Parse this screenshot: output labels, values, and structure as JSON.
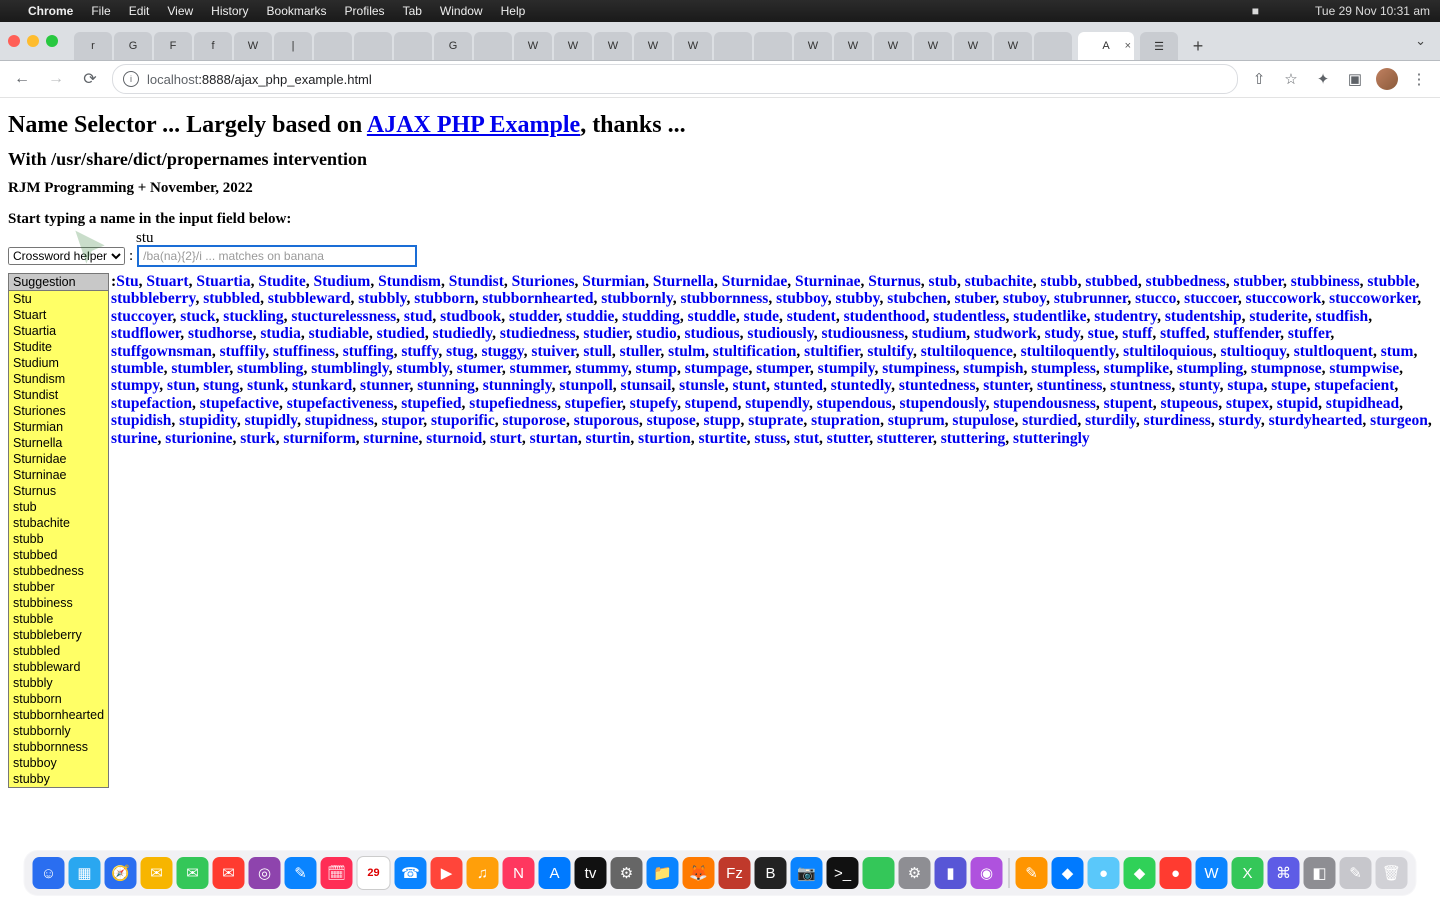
{
  "menubar": {
    "apple": "",
    "app": "Chrome",
    "items": [
      "File",
      "Edit",
      "View",
      "History",
      "Bookmarks",
      "Profiles",
      "Tab",
      "Window",
      "Help"
    ],
    "right": {
      "bt": "",
      "battery": "■",
      "wifi": "",
      "search": "",
      "control": "",
      "clock": "Tue 29 Nov  10:31 am"
    }
  },
  "tabs": {
    "favicons": [
      "r",
      "G",
      "F",
      "f",
      "W",
      "|",
      "",
      "",
      "",
      "G",
      "",
      "W",
      "W",
      "W",
      "W",
      "W",
      "",
      "",
      "W",
      "W",
      "W",
      "W",
      "W",
      "W",
      ""
    ],
    "active_label": "A",
    "active_close": "×",
    "after": [
      "☰"
    ],
    "newtab": "+",
    "dropdown": "⌄"
  },
  "toolbar": {
    "back": "←",
    "fwd": "→",
    "reload": "⟳",
    "info": "i",
    "url_host": "localhost",
    "url_port": ":8888",
    "url_path": "/ajax_php_example.html",
    "share": "⇧",
    "star": "☆",
    "ext": "✦",
    "panel": "▣",
    "menu": "⋮"
  },
  "page": {
    "h1_a": "Name Selector ... Largely based on ",
    "h1_link": "AJAX PHP Example",
    "h1_b": ", thanks ...",
    "h2": "With /usr/share/dict/propernames intervention",
    "h3": "RJM Programming + November, 2022",
    "prompt": "Start typing a name in the input field below:",
    "typed": "stu",
    "select_label": "Crossword helper",
    "sep": ":",
    "input_placeholder": "/ba(na){2}/i ... matches on banana",
    "input_value": "",
    "sugg_header": "Suggestion",
    "suggestions": [
      "Stu",
      "Stuart",
      "Stuartia",
      "Studite",
      "Studium",
      "Stundism",
      "Stundist",
      "Sturiones",
      "Sturmian",
      "Sturnella",
      "Sturnidae",
      "Sturninae",
      "Sturnus",
      "stub",
      "stubachite",
      "stubb",
      "stubbed",
      "stubbedness",
      "stubber",
      "stubbiness",
      "stubble",
      "stubbleberry",
      "stubbled",
      "stubbleward",
      "stubbly",
      "stubborn",
      "stubbornhearted",
      "stubbornly",
      "stubbornness",
      "stubboy",
      "stubby"
    ],
    "results_lead": ":",
    "results": [
      "Stu",
      "Stuart",
      "Stuartia",
      "Studite",
      "Studium",
      "Stundism",
      "Stundist",
      "Sturiones",
      "Sturmian",
      "Sturnella",
      "Sturnidae",
      "Sturninae",
      "Sturnus",
      "stub",
      "stubachite",
      "stubb",
      "stubbed",
      "stubbedness",
      "stubber",
      "stubbiness",
      "stubble",
      "stubbleberry",
      "stubbled",
      "stubbleward",
      "stubbly",
      "stubborn",
      "stubbornhearted",
      "stubbornly",
      "stubbornness",
      "stubboy",
      "stubby",
      "stubchen",
      "stuber",
      "stuboy",
      "stubrunner",
      "stucco",
      "stuccoer",
      "stuccowork",
      "stuccoworker",
      "stuccoyer",
      "stuck",
      "stuckling",
      "stucturelessness",
      "stud",
      "studbook",
      "studder",
      "studdie",
      "studding",
      "studdle",
      "stude",
      "student",
      "studenthood",
      "studentless",
      "studentlike",
      "studentry",
      "studentship",
      "studerite",
      "studfish",
      "studflower",
      "studhorse",
      "studia",
      "studiable",
      "studied",
      "studiedly",
      "studiedness",
      "studier",
      "studio",
      "studious",
      "studiously",
      "studiousness",
      "studium",
      "studwork",
      "study",
      "stue",
      "stuff",
      "stuffed",
      "stuffender",
      "stuffer",
      "stuffgownsman",
      "stuffily",
      "stuffiness",
      "stuffing",
      "stuffy",
      "stug",
      "stuggy",
      "stuiver",
      "stull",
      "stuller",
      "stulm",
      "stultification",
      "stultifier",
      "stultify",
      "stultiloquence",
      "stultiloquently",
      "stultiloquious",
      "stultioquy",
      "stultloquent",
      "stum",
      "stumble",
      "stumbler",
      "stumbling",
      "stumblingly",
      "stumbly",
      "stumer",
      "stummer",
      "stummy",
      "stump",
      "stumpage",
      "stumper",
      "stumpily",
      "stumpiness",
      "stumpish",
      "stumpless",
      "stumplike",
      "stumpling",
      "stumpnose",
      "stumpwise",
      "stumpy",
      "stun",
      "stung",
      "stunk",
      "stunkard",
      "stunner",
      "stunning",
      "stunningly",
      "stunpoll",
      "stunsail",
      "stunsle",
      "stunt",
      "stunted",
      "stuntedly",
      "stuntedness",
      "stunter",
      "stuntiness",
      "stuntness",
      "stunty",
      "stupa",
      "stupe",
      "stupefacient",
      "stupefaction",
      "stupefactive",
      "stupefactiveness",
      "stupefied",
      "stupefiedness",
      "stupefier",
      "stupefy",
      "stupend",
      "stupendly",
      "stupendous",
      "stupendously",
      "stupendousness",
      "stupent",
      "stupeous",
      "stupex",
      "stupid",
      "stupidhead",
      "stupidish",
      "stupidity",
      "stupidly",
      "stupidness",
      "stupor",
      "stuporific",
      "stuporose",
      "stuporous",
      "stupose",
      "stupp",
      "stuprate",
      "stupration",
      "stuprum",
      "stupulose",
      "sturdied",
      "sturdily",
      "sturdiness",
      "sturdy",
      "sturdyhearted",
      "sturgeon",
      "sturine",
      "sturionine",
      "sturk",
      "sturniform",
      "sturnine",
      "sturnoid",
      "sturt",
      "sturtan",
      "sturtin",
      "sturtion",
      "sturtite",
      "stuss",
      "stut",
      "stutter",
      "stutterer",
      "stuttering",
      "stutteringly"
    ]
  },
  "dock": {
    "apps": [
      {
        "c": "#2a6ef0",
        "t": "☺"
      },
      {
        "c": "#2aa7f0",
        "t": "▦"
      },
      {
        "c": "#2a6ef0",
        "t": "🧭"
      },
      {
        "c": "#f7b500",
        "t": "✉"
      },
      {
        "c": "#34c759",
        "t": "✉"
      },
      {
        "c": "#ff3b30",
        "t": "✉"
      },
      {
        "c": "#8e44ad",
        "t": "◎"
      },
      {
        "c": "#0a84ff",
        "t": "✎"
      },
      {
        "c": "#ff2d55",
        "t": "🗓"
      },
      {
        "c": "#ffffff",
        "t": "29"
      },
      {
        "c": "#0a84ff",
        "t": "☎"
      },
      {
        "c": "#ff453a",
        "t": "▶"
      },
      {
        "c": "#ff9f0a",
        "t": "♫"
      },
      {
        "c": "#ff375f",
        "t": "N"
      },
      {
        "c": "#007aff",
        "t": "A"
      },
      {
        "c": "#111",
        "t": "tv"
      },
      {
        "c": "#666",
        "t": "⚙"
      },
      {
        "c": "#0a84ff",
        "t": "📁"
      },
      {
        "c": "#ff7a00",
        "t": "🦊"
      },
      {
        "c": "#c0392b",
        "t": "Fz"
      },
      {
        "c": "#222",
        "t": "B"
      },
      {
        "c": "#0a84ff",
        "t": "📷"
      },
      {
        "c": "#111",
        "t": ">_"
      },
      {
        "c": "#34c759",
        "t": ""
      },
      {
        "c": "#8e8e93",
        "t": "⚙"
      },
      {
        "c": "#5856d6",
        "t": "▮"
      },
      {
        "c": "#af52de",
        "t": "◉"
      },
      {
        "c": "#ff9500",
        "t": "✎"
      },
      {
        "c": "#007aff",
        "t": "◆"
      },
      {
        "c": "#5ac8fa",
        "t": "●"
      },
      {
        "c": "#30d158",
        "t": "◆"
      },
      {
        "c": "#ff3b30",
        "t": "●"
      },
      {
        "c": "#0a84ff",
        "t": "W"
      },
      {
        "c": "#34c759",
        "t": "X"
      },
      {
        "c": "#5e5ce6",
        "t": "⌘"
      },
      {
        "c": "#8e8e93",
        "t": "◧"
      },
      {
        "c": "#c7c7cc",
        "t": "✎"
      },
      {
        "c": "#d1d1d6",
        "t": "🗑"
      }
    ]
  }
}
